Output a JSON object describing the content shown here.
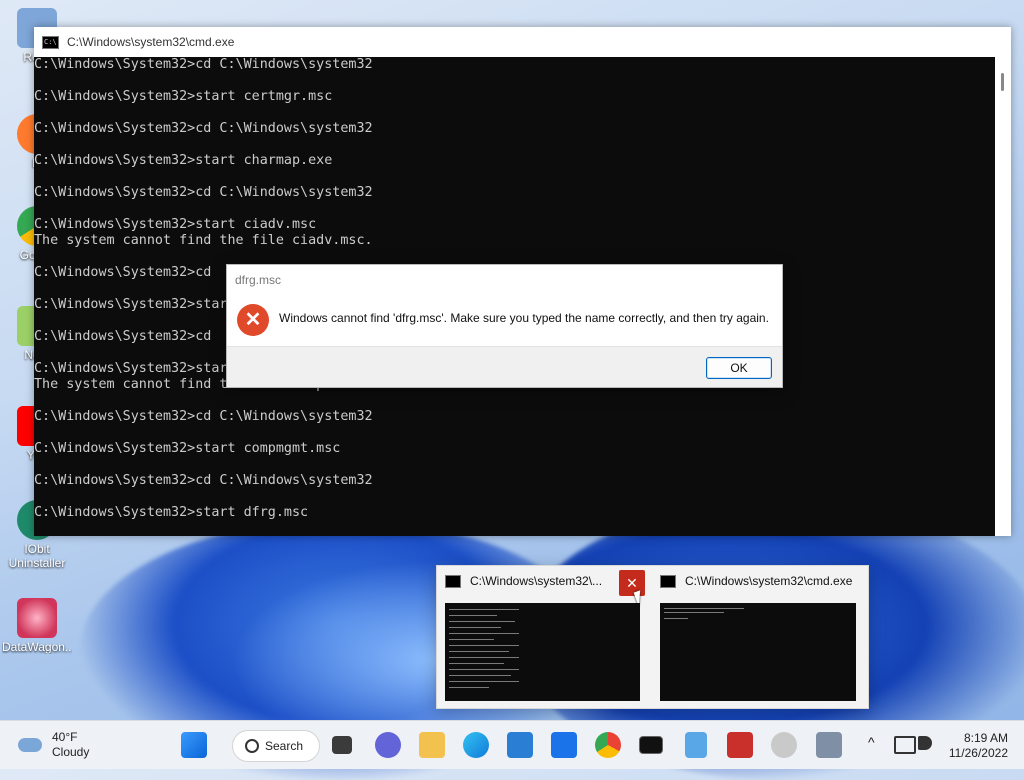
{
  "desktop": {
    "icons": [
      {
        "label": "Recy",
        "color": "#5a88c8"
      },
      {
        "label": "Fi",
        "color": "#ff6a2a"
      },
      {
        "label": "Go Ch",
        "color": "#34a853"
      },
      {
        "label": "Note",
        "color": "#7cc04a"
      },
      {
        "label": "You",
        "color": "#ff0000"
      },
      {
        "label": "IObit Uninstaller",
        "color": "#1e8a6a"
      },
      {
        "label": "DataWagon...",
        "color": "#d0365a"
      }
    ]
  },
  "cmd_window": {
    "title": "C:\\Windows\\system32\\cmd.exe",
    "lines": [
      "C:\\Windows\\System32>cd C:\\Windows\\system32",
      "",
      "C:\\Windows\\System32>start certmgr.msc",
      "",
      "C:\\Windows\\System32>cd C:\\Windows\\system32",
      "",
      "C:\\Windows\\System32>start charmap.exe",
      "",
      "C:\\Windows\\System32>cd C:\\Windows\\system32",
      "",
      "C:\\Windows\\System32>start ciadv.msc",
      "The system cannot find the file ciadv.msc.",
      "",
      "C:\\Windows\\System32>cd",
      "",
      "C:\\Windows\\System32>star",
      "",
      "C:\\Windows\\System32>cd",
      "",
      "C:\\Windows\\System32>star",
      "The system cannot find the file clipbrd.exe.",
      "",
      "C:\\Windows\\System32>cd C:\\Windows\\system32",
      "",
      "C:\\Windows\\System32>start compmgmt.msc",
      "",
      "C:\\Windows\\System32>cd C:\\Windows\\system32",
      "",
      "C:\\Windows\\System32>start dfrg.msc"
    ]
  },
  "dialog": {
    "title": "dfrg.msc",
    "message": "Windows cannot find 'dfrg.msc'. Make sure you typed the name correctly, and then try again.",
    "ok_label": "OK"
  },
  "thumbnails": {
    "items": [
      {
        "title": "C:\\Windows\\system32\\..."
      },
      {
        "title": "C:\\Windows\\system32\\cmd.exe"
      }
    ],
    "close_label": "✕"
  },
  "taskbar": {
    "weather_temp": "40°F",
    "weather_desc": "Cloudy",
    "search_label": "Search",
    "time": "8:19 AM",
    "date": "11/26/2022",
    "chevron": "^"
  }
}
